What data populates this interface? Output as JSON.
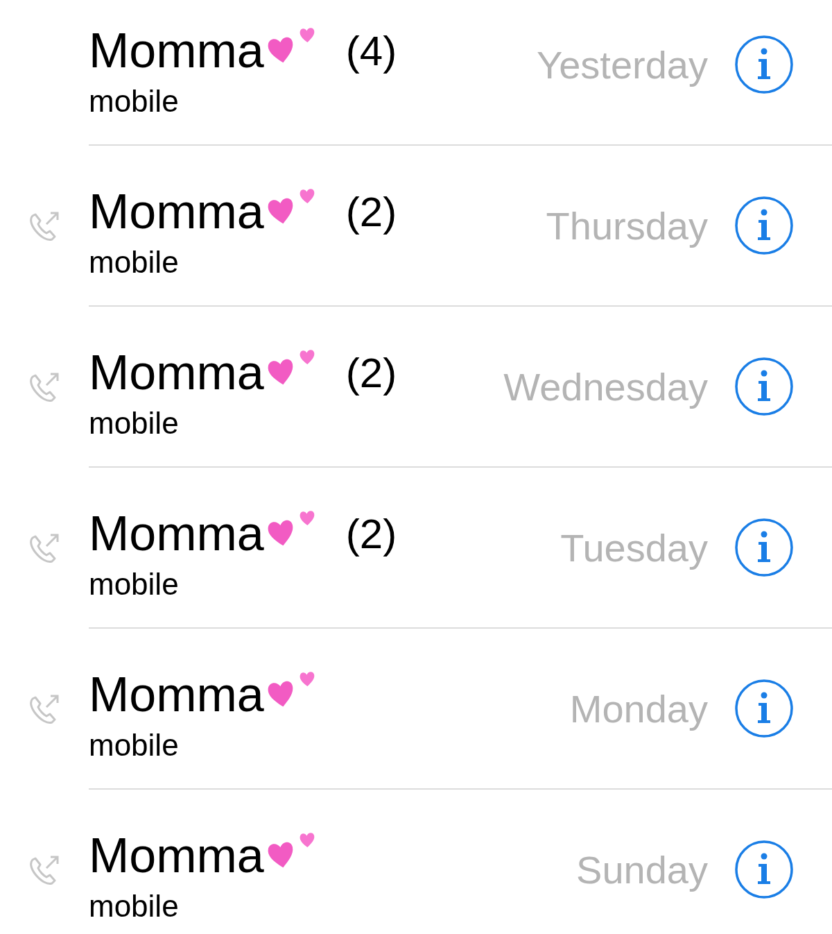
{
  "calls": [
    {
      "name": "Momma",
      "count": "(4)",
      "type": "mobile",
      "date": "Yesterday",
      "outgoing": false
    },
    {
      "name": "Momma",
      "count": "(2)",
      "type": "mobile",
      "date": "Thursday",
      "outgoing": true
    },
    {
      "name": "Momma",
      "count": "(2)",
      "type": "mobile",
      "date": "Wednesday",
      "outgoing": true
    },
    {
      "name": "Momma",
      "count": "(2)",
      "type": "mobile",
      "date": "Tuesday",
      "outgoing": true
    },
    {
      "name": "Momma",
      "type": "mobile",
      "date": "Monday",
      "outgoing": true
    },
    {
      "name": "Momma",
      "type": "mobile",
      "date": "Sunday",
      "outgoing": true
    }
  ]
}
